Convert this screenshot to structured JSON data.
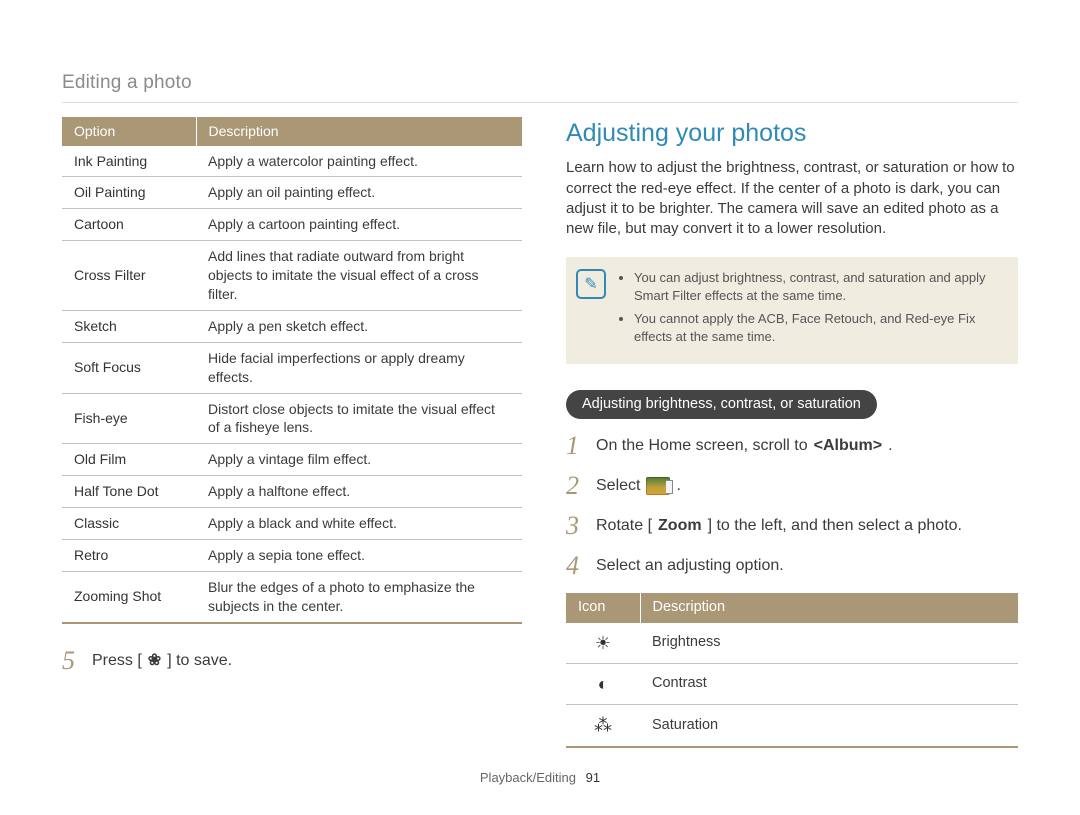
{
  "breadcrumb": "Editing a photo",
  "effectsTable": {
    "headers": {
      "option": "Option",
      "description": "Description"
    },
    "rows": [
      {
        "option": "Ink Painting",
        "description": "Apply a watercolor painting effect."
      },
      {
        "option": "Oil Painting",
        "description": "Apply an oil painting effect."
      },
      {
        "option": "Cartoon",
        "description": "Apply a cartoon painting effect."
      },
      {
        "option": "Cross Filter",
        "description": "Add lines that radiate outward from bright objects to imitate the visual effect of a cross filter."
      },
      {
        "option": "Sketch",
        "description": "Apply a pen sketch effect."
      },
      {
        "option": "Soft Focus",
        "description": "Hide facial imperfections or apply dreamy effects."
      },
      {
        "option": "Fish-eye",
        "description": "Distort close objects to imitate the visual effect of a fisheye lens."
      },
      {
        "option": "Old Film",
        "description": "Apply a vintage film effect."
      },
      {
        "option": "Half Tone Dot",
        "description": "Apply a halftone effect."
      },
      {
        "option": "Classic",
        "description": "Apply a black and white effect."
      },
      {
        "option": "Retro",
        "description": "Apply a sepia tone effect."
      },
      {
        "option": "Zooming Shot",
        "description": "Blur the edges of a photo to emphasize the subjects in the center."
      }
    ]
  },
  "step5": {
    "num": "5",
    "pre": "Press [",
    "post": "] to save."
  },
  "heading": "Adjusting your photos",
  "intro": "Learn how to adjust the brightness, contrast, or saturation or how to correct the red-eye effect. If the center of a photo is dark, you can adjust it to be brighter. The camera will save an edited photo as a new file, but may convert it to a lower resolution.",
  "notes": [
    "You can adjust brightness, contrast, and saturation and apply Smart Filter effects at the same time.",
    "You cannot apply the ACB, Face Retouch, and Red-eye Fix effects at the same time."
  ],
  "pill": "Adjusting brightness, contrast, or saturation",
  "steps": {
    "s1": {
      "num": "1",
      "pre": "On the Home screen, scroll to ",
      "bold": "<Album>",
      "post": "."
    },
    "s2": {
      "num": "2",
      "pre": "Select ",
      "post": "."
    },
    "s3": {
      "num": "3",
      "pre": "Rotate [",
      "bold": "Zoom",
      "post": "] to the left, and then select a photo."
    },
    "s4": {
      "num": "4",
      "text": "Select an adjusting option."
    }
  },
  "iconTable": {
    "headers": {
      "icon": "Icon",
      "description": "Description"
    },
    "rows": [
      {
        "glyph": "☀",
        "label": "Brightness"
      },
      {
        "glyph": "◐",
        "label": "Contrast"
      },
      {
        "glyph": "⁂",
        "label": "Saturation"
      }
    ]
  },
  "footer": {
    "section": "Playback/Editing",
    "page": "91"
  }
}
